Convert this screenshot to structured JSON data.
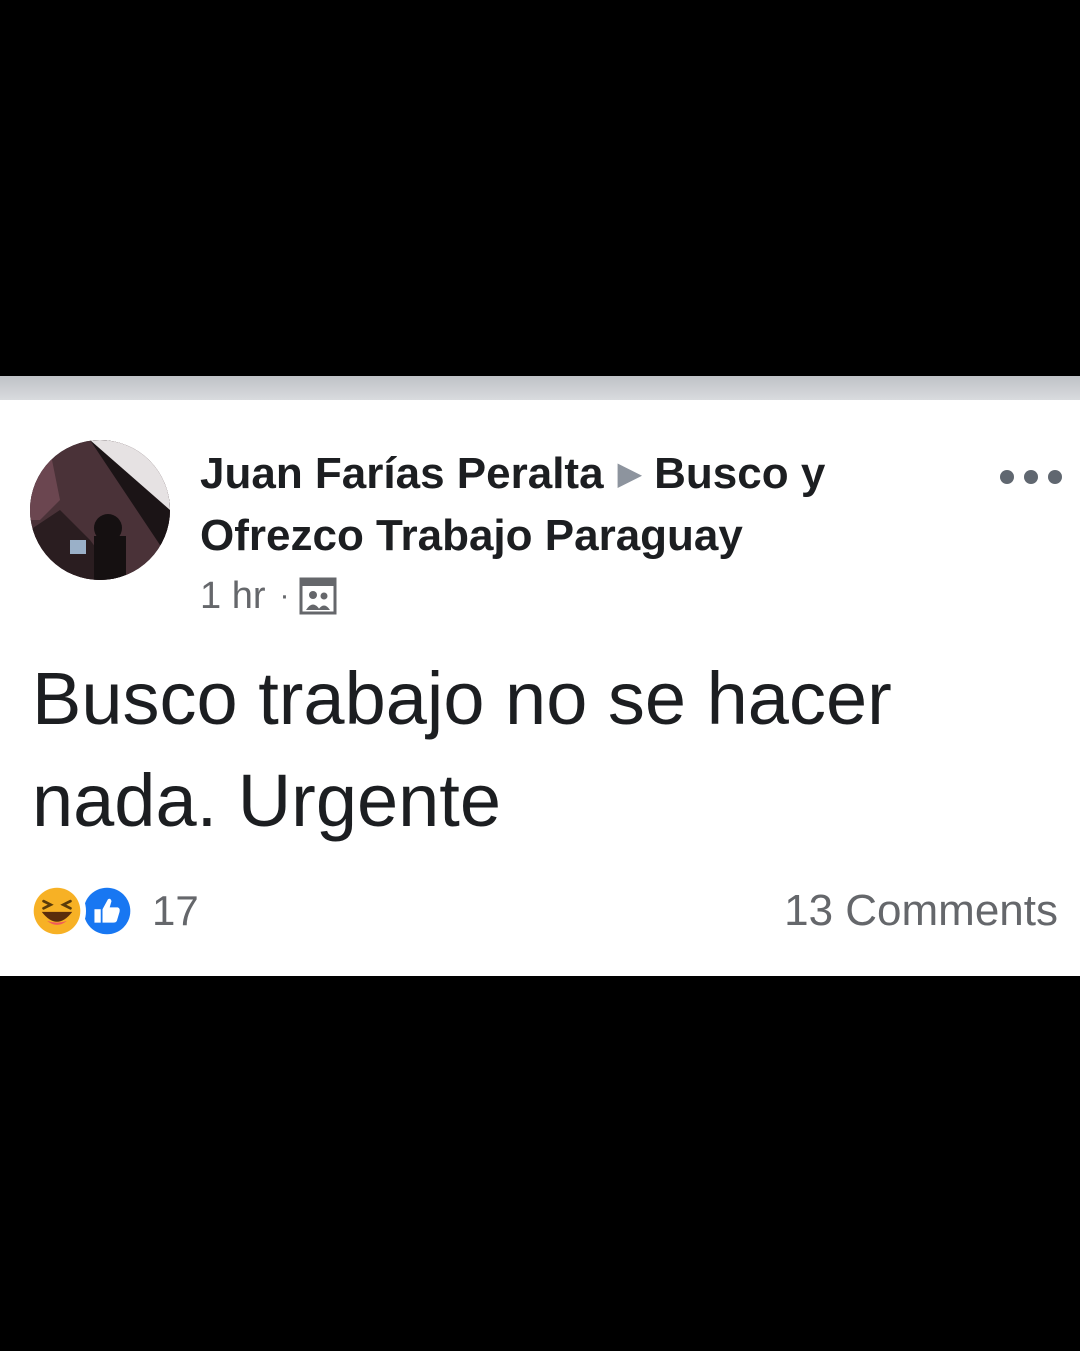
{
  "post": {
    "author": "Juan Farías Peralta",
    "group": "Busco y Ofrezco Trabajo Paraguay",
    "timestamp": "1 hr",
    "separator": "·",
    "audience_icon": "group-audience-icon",
    "body": "Busco trabajo no se hacer nada. Urgente",
    "reactions": {
      "icons": [
        "haha-icon",
        "like-icon"
      ],
      "count": "17"
    },
    "comments_label": "13 Comments"
  },
  "colors": {
    "text_primary": "#1c1e21",
    "text_secondary": "#65676b",
    "like_blue": "#1877f2",
    "haha_yellow": "#f7b125"
  }
}
